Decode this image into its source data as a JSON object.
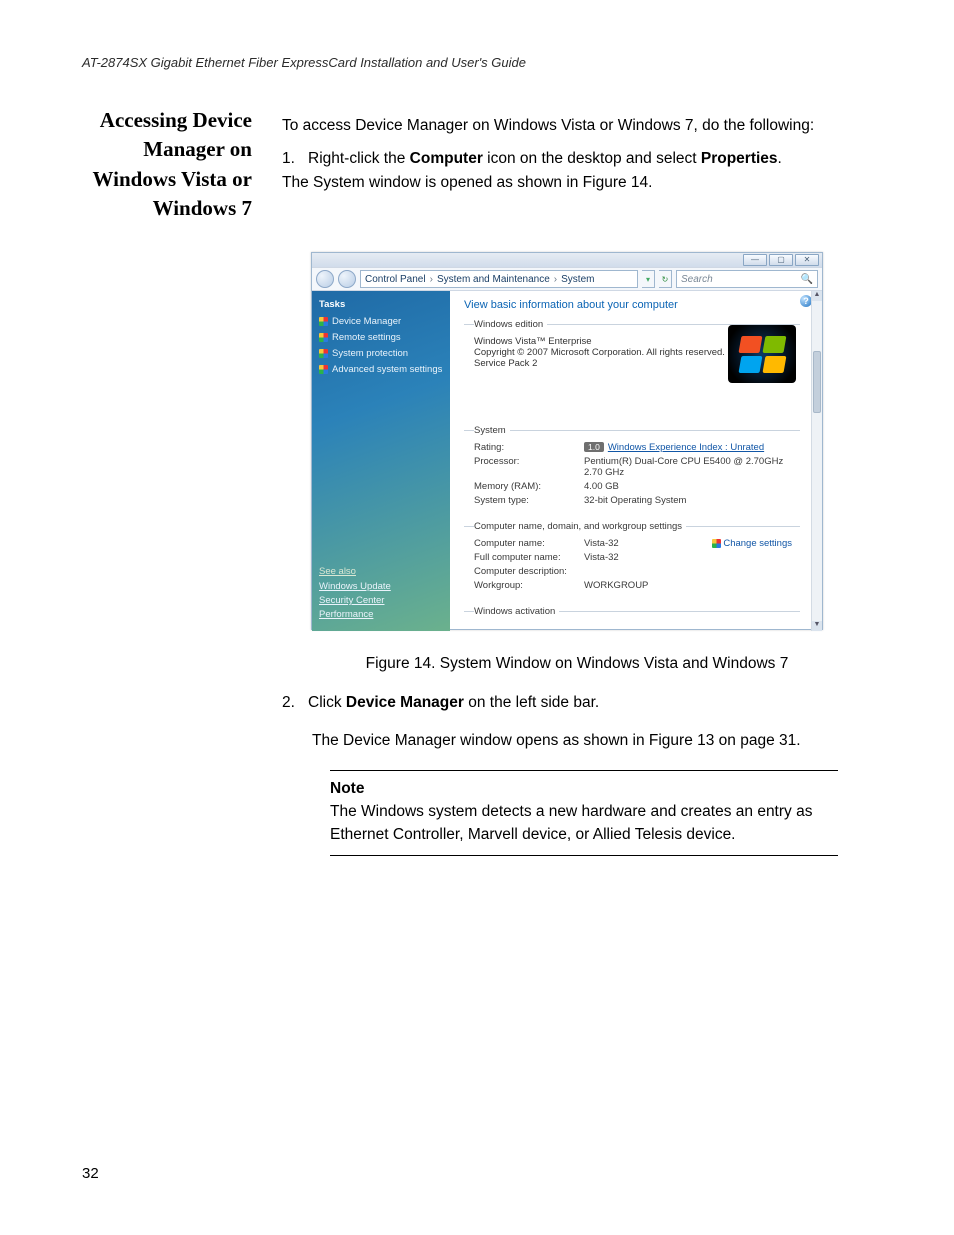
{
  "doc": {
    "running_header": "AT-2874SX Gigabit Ethernet Fiber ExpressCard Installation and User's Guide",
    "page_number": "32",
    "section_title": "Accessing Device Manager on Windows Vista or Windows 7",
    "intro": "To access Device Manager on Windows Vista or Windows 7, do the following:",
    "step1_num": "1.",
    "step1_a": "Right-click the ",
    "step1_bold1": "Computer",
    "step1_b": " icon on the desktop and select ",
    "step1_bold2": "Properties",
    "step1_c": ".",
    "step1_result": "The System window is opened as shown in Figure 14.",
    "figure_caption": "Figure 14. System Window on Windows Vista and Windows 7",
    "step2_num": "2.",
    "step2_a": "Click ",
    "step2_bold": "Device Manager",
    "step2_b": " on the left side bar.",
    "step2_result": "The Device Manager window opens as shown in Figure 13 on page 31.",
    "note_label": "Note",
    "note_body": "The Windows system detects a new hardware and creates an entry as Ethernet Controller, Marvell device, or Allied Telesis device."
  },
  "win": {
    "titlebar": {
      "min": "—",
      "max": "▢",
      "close": "✕"
    },
    "breadcrumb": {
      "p1": "Control Panel",
      "p2": "System and Maintenance",
      "p3": "System",
      "sep": "›"
    },
    "search_placeholder": "Search",
    "refresh_glyph": "↻",
    "tasks_title": "Tasks",
    "tasks": {
      "device_manager": "Device Manager",
      "remote_settings": "Remote settings",
      "system_protection": "System protection",
      "advanced": "Advanced system settings"
    },
    "see_also_hdr": "See also",
    "see_also": {
      "windows_update": "Windows Update",
      "security_center": "Security Center",
      "performance": "Performance"
    },
    "heading": "View basic information about your computer",
    "edition_legend": "Windows edition",
    "edition_name": "Windows Vista™ Enterprise",
    "edition_copy": "Copyright © 2007 Microsoft Corporation.  All rights reserved.",
    "edition_sp": "Service Pack 2",
    "system_legend": "System",
    "sys": {
      "rating_k": "Rating:",
      "rating_badge": "1.0",
      "rating_v": "Windows Experience Index : Unrated",
      "proc_k": "Processor:",
      "proc_v": "Pentium(R) Dual-Core  CPU      E5400  @ 2.70GHz  2.70 GHz",
      "mem_k": "Memory (RAM):",
      "mem_v": "4.00 GB",
      "type_k": "System type:",
      "type_v": "32-bit Operating System"
    },
    "comp_legend": "Computer name, domain, and workgroup settings",
    "comp": {
      "name_k": "Computer name:",
      "name_v": "Vista-32",
      "full_k": "Full computer name:",
      "full_v": "Vista-32",
      "desc_k": "Computer description:",
      "desc_v": "",
      "wg_k": "Workgroup:",
      "wg_v": "WORKGROUP",
      "change": "Change settings"
    },
    "activation_legend": "Windows activation"
  }
}
